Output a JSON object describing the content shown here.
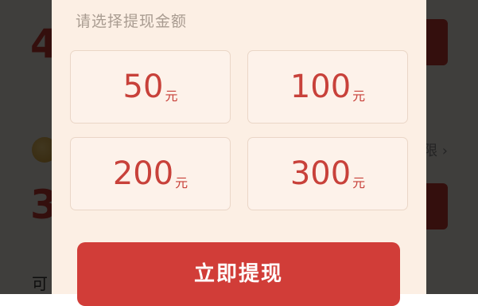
{
  "background": {
    "amount_top": "4",
    "amount_bottom": "3",
    "more_text": "限 ›",
    "footer_text": "可"
  },
  "modal": {
    "title": "请选择提现金额",
    "options": [
      {
        "value": "50",
        "unit": "元"
      },
      {
        "value": "100",
        "unit": "元"
      },
      {
        "value": "200",
        "unit": "元"
      },
      {
        "value": "300",
        "unit": "元"
      }
    ],
    "submit_label": "立即提现"
  },
  "colors": {
    "accent": "#d13d38",
    "option_text": "#c8413a",
    "sheet_bg": "#fcefe4"
  }
}
